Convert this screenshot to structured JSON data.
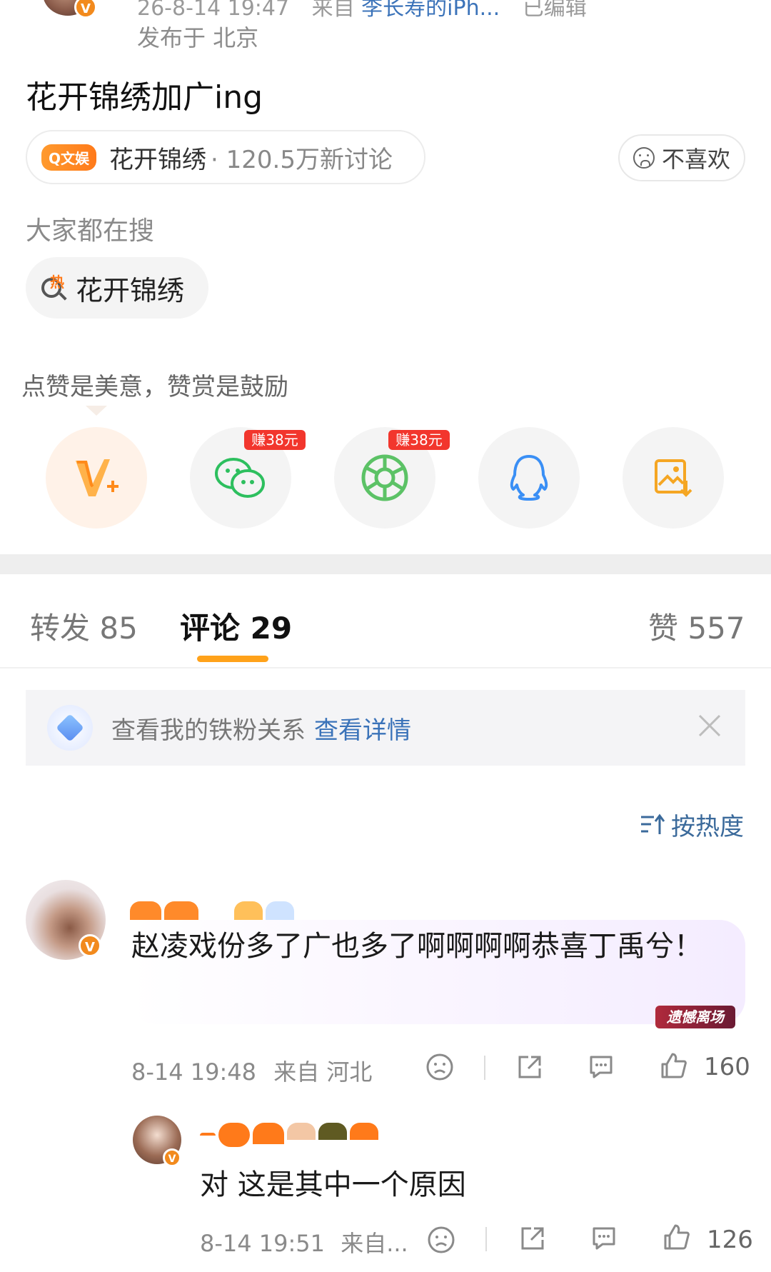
{
  "post": {
    "meta_time": "26-8-14 19:47",
    "meta_from": "来自",
    "meta_source": "李长寿的iPh...",
    "meta_edited": "已编辑",
    "published": "发布于 北京",
    "text": "花开锦绣加广ing",
    "topic_tag": "Q文娱",
    "topic_name": "花开锦绣",
    "topic_discussion": "· 120.5万新讨论",
    "dislike": "不喜欢"
  },
  "search": {
    "label": "大家都在搜",
    "hot_badge": "热",
    "term": "花开锦绣"
  },
  "praise": {
    "text": "点赞是美意，赞赏是鼓励",
    "earn_badge_1": "赚38元",
    "earn_badge_2": "赚38元",
    "icons": [
      "vplus-icon",
      "wechat-icon",
      "moments-icon",
      "qq-icon",
      "save-image-icon"
    ]
  },
  "tabs": {
    "repost": "转发 85",
    "comments": "评论 29",
    "likes": "赞 557"
  },
  "fan_bar": {
    "text": "查看我的铁粉关系",
    "link": "查看详情"
  },
  "sort": {
    "label": "按热度"
  },
  "comments": [
    {
      "text": "赵凌戏份多了广也多了啊啊啊啊恭喜丁禹兮！",
      "badge": "遗憾离场",
      "time": "8-14 19:48",
      "location": "来自 河北",
      "likes": "160"
    },
    {
      "text": "对 这是其中一个原因",
      "time": "8-14 19:51",
      "location": "来自...",
      "likes": "126"
    }
  ],
  "colors": {
    "accent": "#ffa21a",
    "link": "#3b73b9",
    "badge_red": "#f2362d"
  }
}
